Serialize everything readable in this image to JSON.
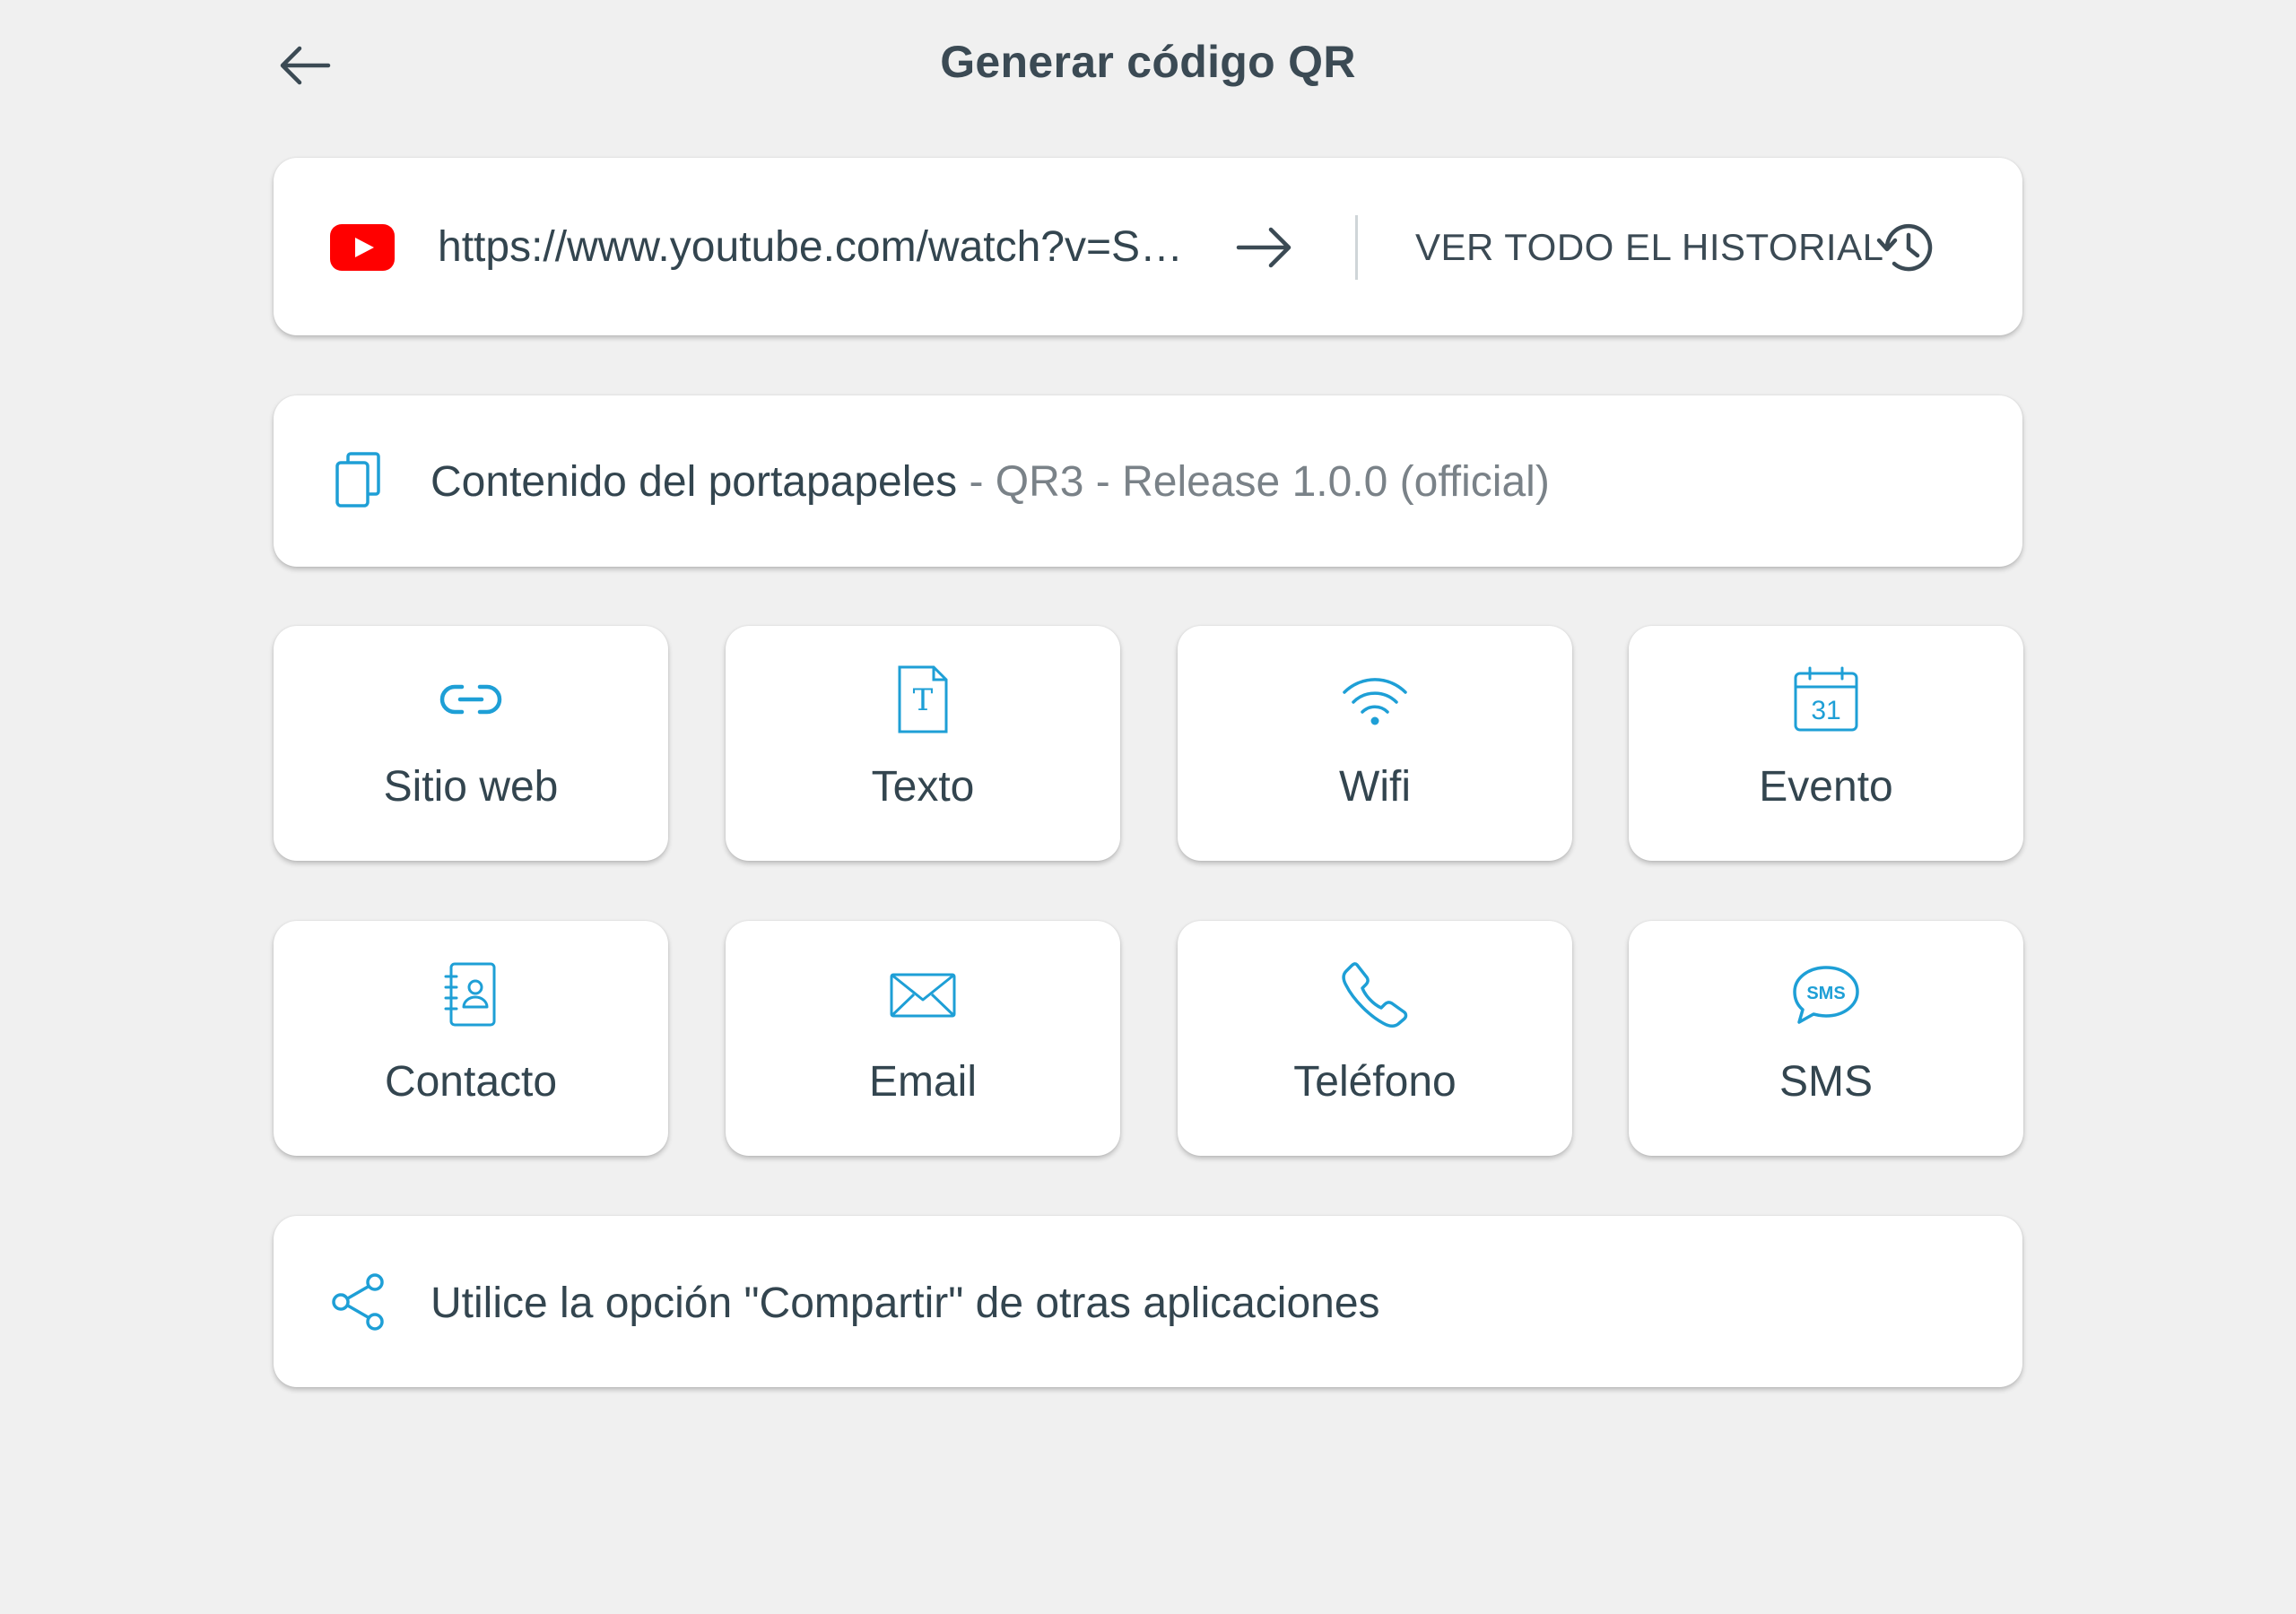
{
  "header": {
    "title": "Generar código QR",
    "back_icon": "arrow-left-icon"
  },
  "history": {
    "source_icon": "youtube-icon",
    "url": "https://www.youtube.com/watch?v=S…",
    "go_icon": "arrow-right-icon",
    "view_all_label": "VER TODO EL HISTORIAL",
    "view_all_icon": "history-icon"
  },
  "clipboard": {
    "icon": "clipboard-copy-icon",
    "label": "Contenido del portapapeles",
    "content": " - QR3 - Release 1.0.0 (official)"
  },
  "types": [
    {
      "label": "Sitio web",
      "icon": "link-icon"
    },
    {
      "label": "Texto",
      "icon": "text-icon"
    },
    {
      "label": "Wifi",
      "icon": "wifi-icon"
    },
    {
      "label": "Evento",
      "icon": "calendar-icon"
    },
    {
      "label": "Contacto",
      "icon": "contact-book-icon"
    },
    {
      "label": "Email",
      "icon": "envelope-icon"
    },
    {
      "label": "Teléfono",
      "icon": "phone-icon"
    },
    {
      "label": "SMS",
      "icon": "sms-bubble-icon"
    }
  ],
  "calendar_day": "31",
  "sms_badge": "SMS",
  "text_glyph": "T",
  "share": {
    "icon": "share-icon",
    "label": "Utilice la opción \"Compartir\" de otras aplicaciones"
  },
  "colors": {
    "accent": "#1e9fd6",
    "youtube_red": "#ff0000",
    "background": "#f0f0f0",
    "text": "#33454f"
  }
}
